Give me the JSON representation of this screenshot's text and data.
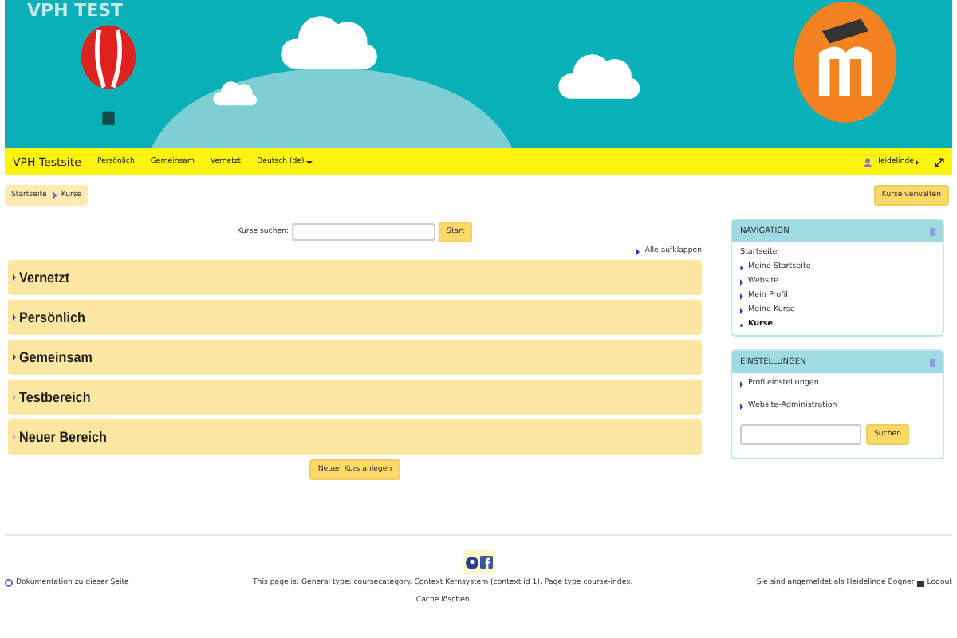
{
  "banner": {
    "title": "VPH TEST"
  },
  "navbar": {
    "brand": "VPH Testsite",
    "items": [
      "Persönlich",
      "Gemeinsam",
      "Vernetzt"
    ],
    "language": "Deutsch (de)",
    "user": "Heidelinde"
  },
  "breadcrumb": [
    "Startseite",
    "Kurse"
  ],
  "manage_button": "Kurse verwalten",
  "search": {
    "label": "Kurse suchen:",
    "button": "Start"
  },
  "expand_all": "Alle aufklappen",
  "categories": [
    {
      "name": "Vernetzt",
      "has_courses": true
    },
    {
      "name": "Persönlich",
      "has_courses": true
    },
    {
      "name": "Gemeinsam",
      "has_courses": true
    },
    {
      "name": "Testbereich",
      "has_courses": false
    },
    {
      "name": "Neuer Bereich",
      "has_courses": false
    }
  ],
  "new_course_button": "Neuen Kurs anlegen",
  "navigation": {
    "title": "NAVIGATION",
    "root": "Startseite",
    "items": [
      {
        "label": "Meine Startseite",
        "kind": "leaf",
        "selected": false
      },
      {
        "label": "Website",
        "kind": "branch",
        "selected": false
      },
      {
        "label": "Mein Profil",
        "kind": "branch",
        "selected": false
      },
      {
        "label": "Meine Kurse",
        "kind": "branch",
        "selected": false
      },
      {
        "label": "Kurse",
        "kind": "leaf",
        "selected": true
      }
    ]
  },
  "settings": {
    "title": "EINSTELLUNGEN",
    "items": [
      "Profileinstellungen",
      "Website-Administration"
    ],
    "search_button": "Suchen"
  },
  "footer": {
    "docs": "Dokumentation zu dieser Seite",
    "info": "This page is: General type: coursecategory. Context Kernsystem (context id 1). Page type course-index.",
    "cache": "Cache löschen",
    "login": "Sie sind angemeldet als Heidelinde Bogner",
    "logout": "Logout"
  }
}
